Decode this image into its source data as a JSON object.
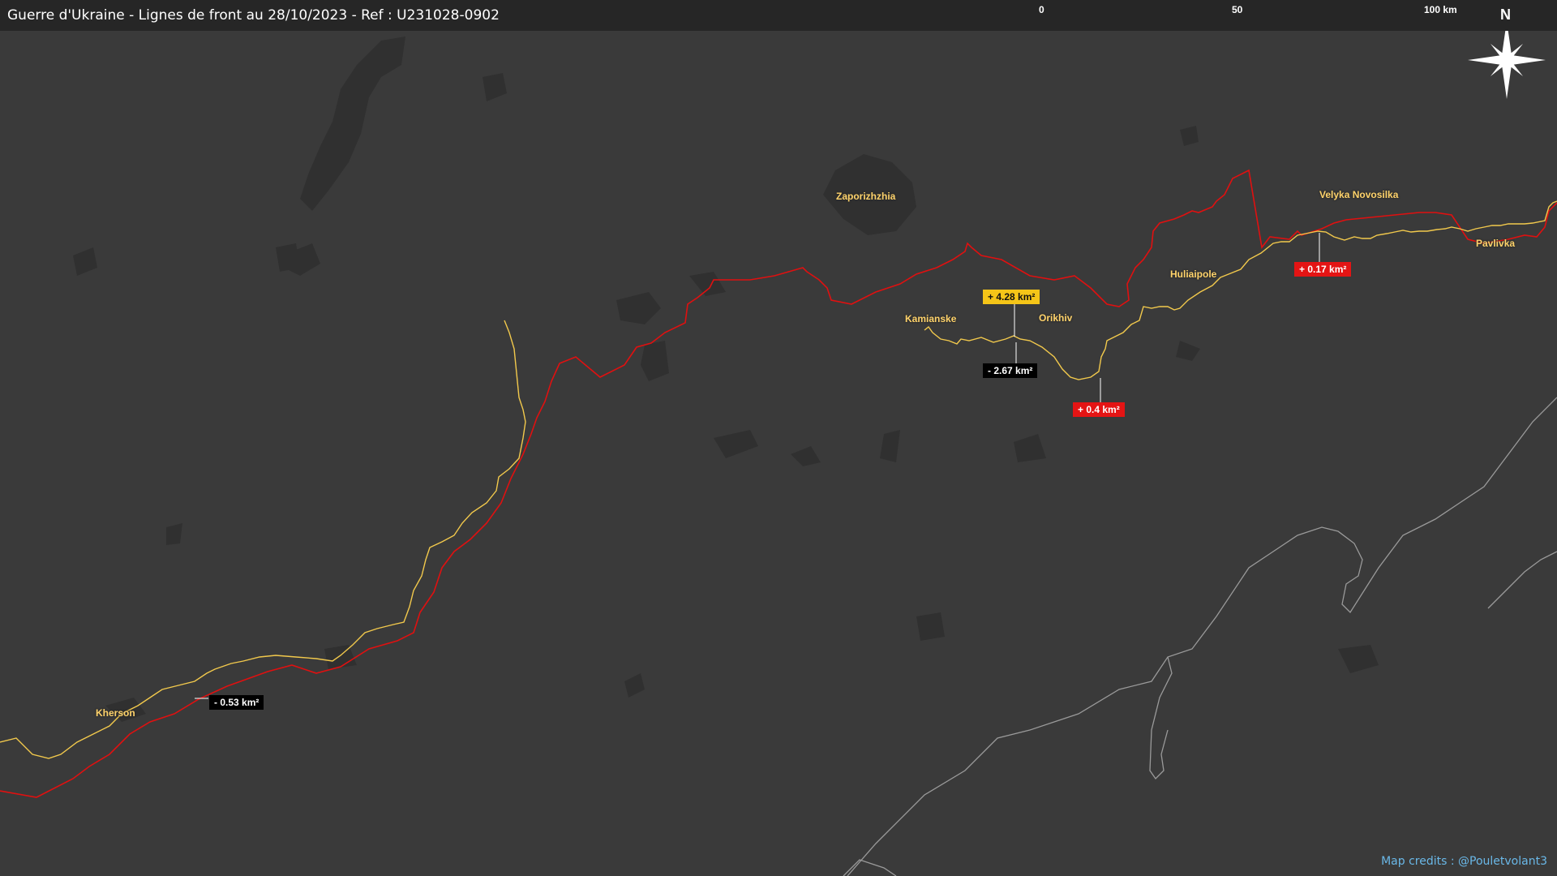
{
  "header": {
    "title": "Guerre d'Ukraine - Lignes de front au 28/10/2023 - Ref : U231028-0902"
  },
  "scale_bar": {
    "labels": [
      "0",
      "50",
      "100 km"
    ]
  },
  "compass": {
    "north_label": "N",
    "icon": "compass-rose-icon"
  },
  "places": [
    {
      "id": "zaporizhzhia",
      "name": "Zaporizhzhia"
    },
    {
      "id": "velyka-novosilka",
      "name": "Velyka Novosilka"
    },
    {
      "id": "pavlivka",
      "name": "Pavlivka"
    },
    {
      "id": "huliaipole",
      "name": "Huliaipole"
    },
    {
      "id": "kamianske",
      "name": "Kamianske"
    },
    {
      "id": "orikhiv",
      "name": "Orikhiv"
    },
    {
      "id": "kherson",
      "name": "Kherson"
    }
  ],
  "area_changes": [
    {
      "id": "orikhiv-gain",
      "text": "+ 4.28 km²",
      "style": "yellow"
    },
    {
      "id": "orikhiv-loss",
      "text": "- 2.67 km²",
      "style": "black"
    },
    {
      "id": "south-orikhiv",
      "text": "+ 0.4 km²",
      "style": "red"
    },
    {
      "id": "velyka-novosilka",
      "text": "+ 0.17 km²",
      "style": "red"
    },
    {
      "id": "kherson",
      "text": "- 0.53 km²",
      "style": "black"
    }
  ],
  "lines": {
    "front_line_color": "#f2c94c",
    "previous_line_color": "#e01010",
    "coastline_color": "#9a9a9a",
    "land_color": "#3a3a3a",
    "water_color": "#303030"
  },
  "credits": {
    "text": "Map credits : @Pouletvolant3"
  }
}
